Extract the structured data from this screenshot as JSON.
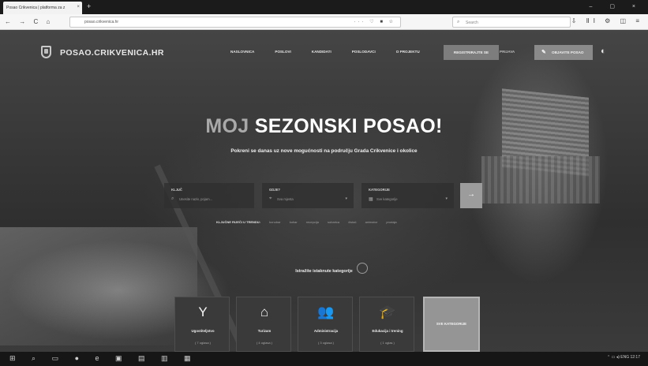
{
  "browser": {
    "tab_title": "Posao Crikvenica | platforma za z",
    "tab_close": "×",
    "new_tab": "+",
    "window_controls": "–  ▢  ×",
    "nav_buttons": "← → C ⌂",
    "url": "posao.crikvenica.hr",
    "url_icons": "··· ♡ ■ ☆",
    "search_placeholder": "Search",
    "toolbar_icons": "⇩ ⅡⅠ ⚙ ◫ ≡"
  },
  "header": {
    "site_name": "POSAO.CRIKVENICA.HR",
    "menu": [
      "NASLOVNICA",
      "POSLOVI",
      "KANDIDATI",
      "POSLODAVCI",
      "O PROJEKTU"
    ],
    "register_label": "REGISTRIRAJTE SE",
    "login_label": "PRIJAVA",
    "post_job_label": "OBJAVITE POSAO"
  },
  "hero": {
    "title_light": "MOJ",
    "title_bold": "SEZONSKI POSAO!",
    "subtitle": "Pokreni se danas uz nove mogućnosti na području Grada Crikvenice i okolice"
  },
  "search": {
    "keyword": {
      "label": "KLJUČ",
      "placeholder": "Unesite naziv, pojam..."
    },
    "location": {
      "label": "GDJE?",
      "placeholder": "Sva mjesta"
    },
    "category": {
      "label": "KATEGORIJE",
      "placeholder": "Sve kategorije"
    },
    "submit": "→"
  },
  "keywords": {
    "label": "KLJUČNE RIJEČI U TRENDU:",
    "items": [
      "konobar",
      "kuhar",
      "recepcija",
      "sobarica",
      "čistač",
      "animator",
      "prodaja"
    ]
  },
  "featured_label": "Istražite istaknute kategorije",
  "categories": [
    {
      "icon": "Y",
      "name": "Ugostiteljstvo",
      "count": "( 7 oglasa )"
    },
    {
      "icon": "⌂",
      "name": "Turizam",
      "count": "( 4 oglasa )"
    },
    {
      "icon": "👥",
      "name": "Administracija",
      "count": "( 3 oglasa )"
    },
    {
      "icon": "🎓",
      "name": "Edukacija i trening",
      "count": "( 1 oglas )"
    }
  ],
  "all_categories_label": "SVE KATEGORIJE",
  "taskbar": {
    "left_icons": "⊞ ⌕ ▭ ● e ▣ ▤ ▥ ▦",
    "right_text": "⌃ ▭ ◂) ENG  12:17"
  }
}
